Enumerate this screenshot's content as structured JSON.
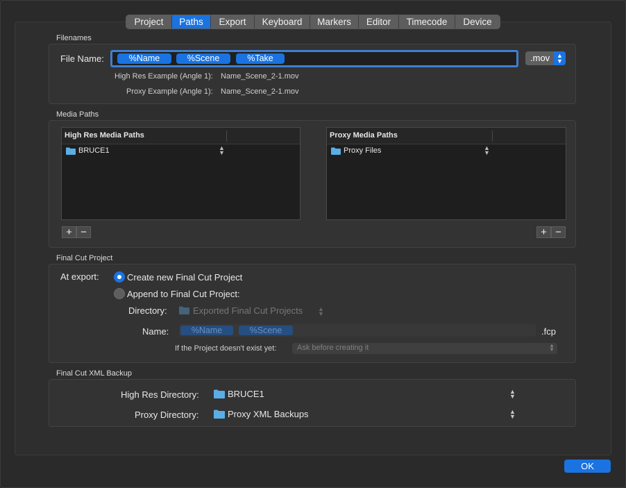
{
  "tabs": [
    {
      "label": "Project"
    },
    {
      "label": "Paths",
      "selected": true
    },
    {
      "label": "Export"
    },
    {
      "label": "Keyboard"
    },
    {
      "label": "Markers"
    },
    {
      "label": "Editor"
    },
    {
      "label": "Timecode"
    },
    {
      "label": "Device"
    }
  ],
  "filenames": {
    "section_title": "Filenames",
    "file_name_label": "File Name:",
    "tokens": [
      "%Name",
      "%Scene",
      "%Take"
    ],
    "extension": ".mov",
    "high_res_example_label": "High Res Example (Angle 1):",
    "high_res_example_value": "Name_Scene_2-1.mov",
    "proxy_example_label": "Proxy Example (Angle 1):",
    "proxy_example_value": "Name_Scene_2-1.mov"
  },
  "media_paths": {
    "section_title": "Media Paths",
    "high_res": {
      "header": "High Res Media Paths",
      "rows": [
        "BRUCE1"
      ]
    },
    "proxy": {
      "header": "Proxy Media Paths",
      "rows": [
        "Proxy Files"
      ]
    },
    "add_symbol": "+",
    "remove_symbol": "−"
  },
  "final_cut_project": {
    "section_title": "Final Cut Project",
    "at_export_label": "At export:",
    "option_create": "Create new Final Cut Project",
    "option_append": "Append to Final Cut Project:",
    "selected_option": "create",
    "directory_label": "Directory:",
    "directory_value": "Exported Final Cut Projects",
    "name_label": "Name:",
    "name_tokens": [
      "%Name",
      "%Scene"
    ],
    "name_extension": ".fcp",
    "doesnt_exist_label": "If the Project doesn't exist yet:",
    "doesnt_exist_value": "Ask before creating it"
  },
  "xml_backup": {
    "section_title": "Final Cut XML Backup",
    "high_res_dir_label": "High Res Directory:",
    "high_res_dir_value": "BRUCE1",
    "proxy_dir_label": "Proxy Directory:",
    "proxy_dir_value": "Proxy XML Backups"
  },
  "ok_label": "OK",
  "colors": {
    "accent": "#1a73e0",
    "folder": "#5aaee8",
    "background": "#2a2a2a"
  }
}
